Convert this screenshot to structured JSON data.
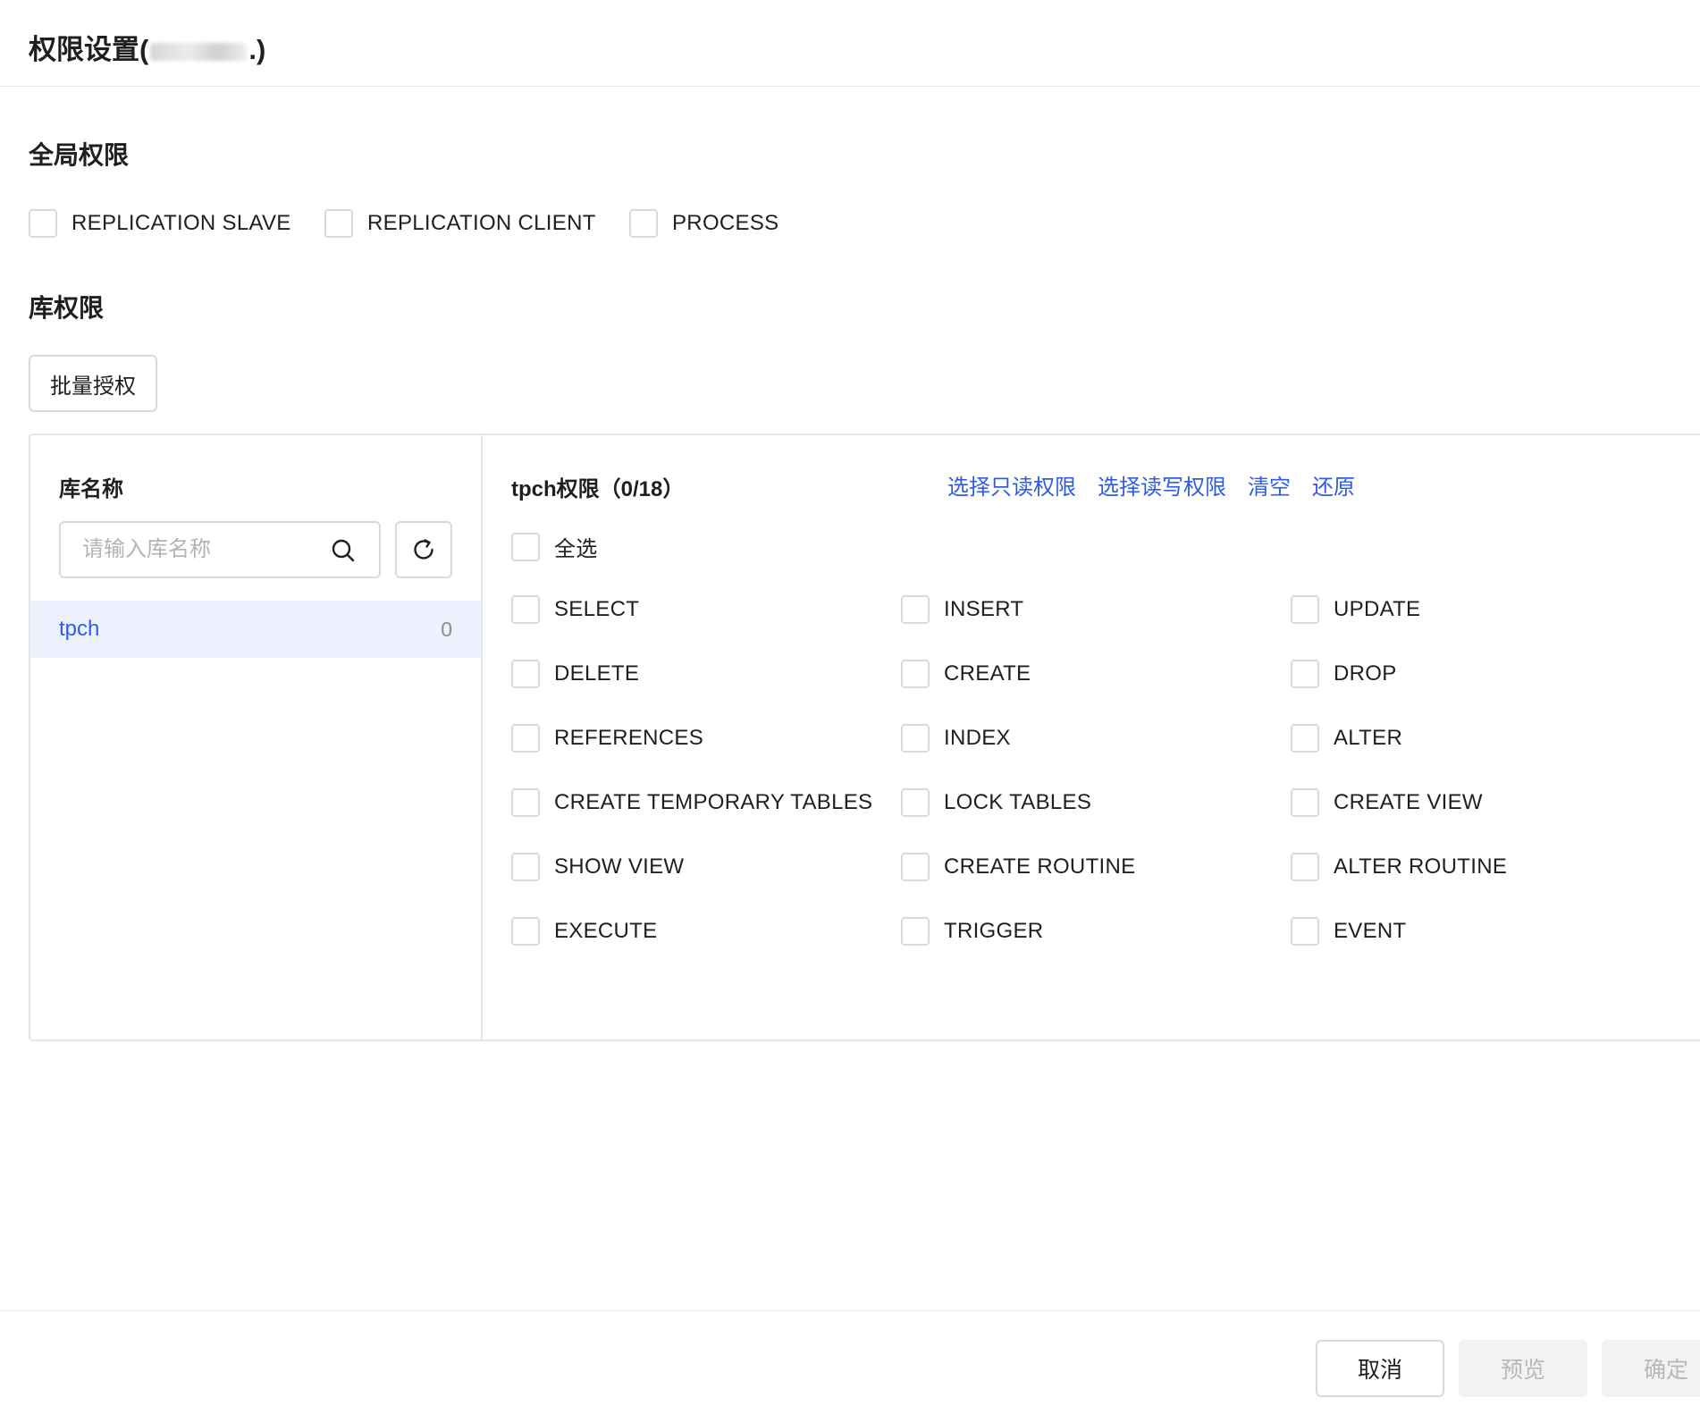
{
  "header": {
    "title_prefix": "权限设置(",
    "title_suffix": ".)"
  },
  "global": {
    "title": "全局权限",
    "options": [
      "REPLICATION SLAVE",
      "REPLICATION CLIENT",
      "PROCESS"
    ]
  },
  "db": {
    "title": "库权限",
    "batch_label": "批量授权",
    "left": {
      "title": "库名称",
      "search_placeholder": "请输入库名称",
      "items": [
        {
          "name": "tpch",
          "count": "0"
        }
      ]
    },
    "right": {
      "title": "tpch权限（0/18）",
      "links": [
        "选择只读权限",
        "选择读写权限",
        "清空",
        "还原"
      ],
      "select_all": "全选",
      "privileges": [
        "SELECT",
        "INSERT",
        "UPDATE",
        "DELETE",
        "CREATE",
        "DROP",
        "REFERENCES",
        "INDEX",
        "ALTER",
        "CREATE TEMPORARY TABLES",
        "LOCK TABLES",
        "CREATE VIEW",
        "SHOW VIEW",
        "CREATE ROUTINE",
        "ALTER ROUTINE",
        "EXECUTE",
        "TRIGGER",
        "EVENT"
      ]
    }
  },
  "footer": {
    "cancel": "取消",
    "preview": "预览",
    "confirm": "确定"
  }
}
